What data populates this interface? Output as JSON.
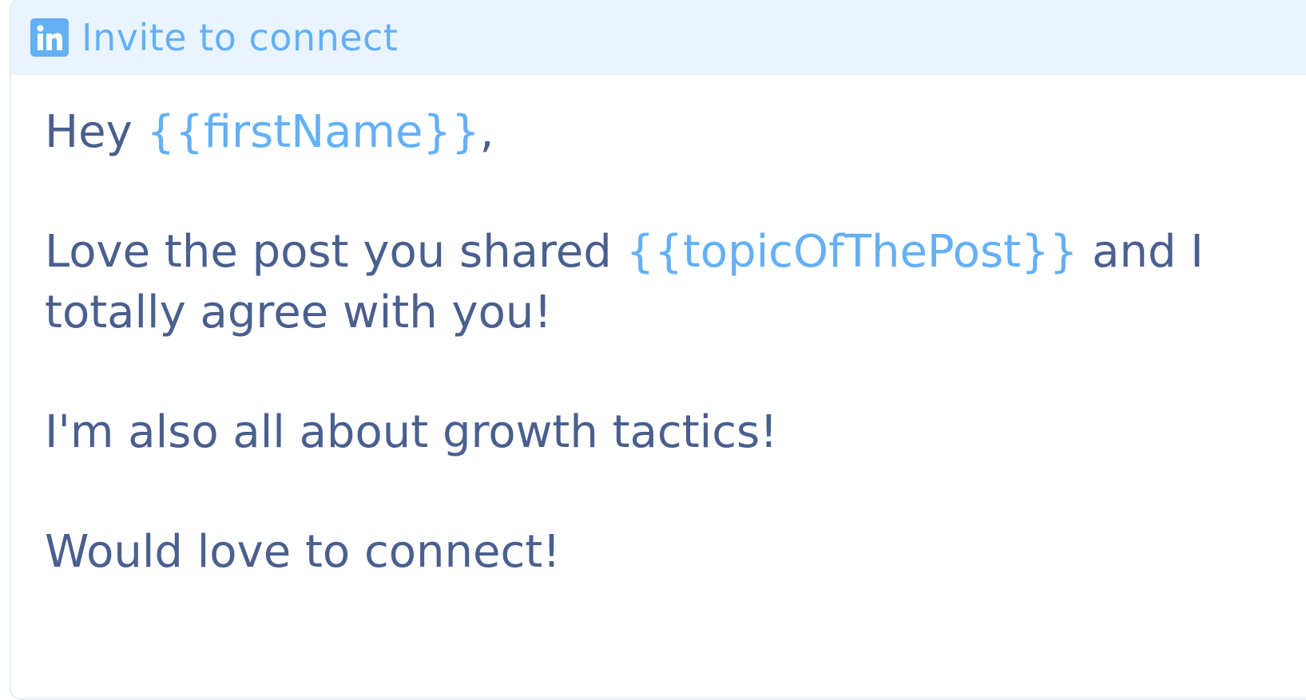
{
  "header": {
    "icon": "linkedin-icon",
    "title": "Invite to connect"
  },
  "message": {
    "greeting_prefix": "Hey ",
    "greeting_variable": "{{firstName}}",
    "greeting_suffix": ",",
    "line2_prefix": "Love the post you shared ",
    "line2_variable": "{{topicOfThePost}}",
    "line2_suffix": " and I totally agree with you!",
    "line3": "I'm also all about growth tactics!",
    "line4": "Would love to connect!"
  },
  "colors": {
    "accent": "#63b0f6",
    "header_bg": "#e9f4ff",
    "text": "#4a5f8e",
    "border": "#e3eef9"
  }
}
